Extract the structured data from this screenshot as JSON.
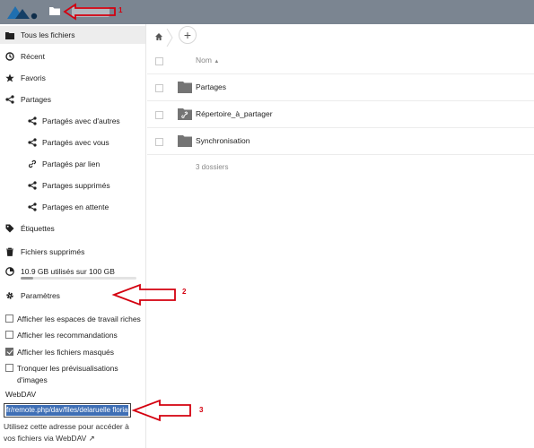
{
  "topbar": {
    "logo_icon": "nextcloud-logo-icon",
    "files_icon": "folder-icon"
  },
  "sidebar": {
    "items": [
      {
        "label": "Tous les fichiers",
        "icon": "folder-icon"
      },
      {
        "label": "Récent",
        "icon": "clock-icon"
      },
      {
        "label": "Favoris",
        "icon": "star-icon"
      },
      {
        "label": "Partages",
        "icon": "share-icon"
      },
      {
        "label": "Partagés avec d'autres",
        "icon": "share-icon"
      },
      {
        "label": "Partagés avec vous",
        "icon": "share-icon"
      },
      {
        "label": "Partagés par lien",
        "icon": "link-icon"
      },
      {
        "label": "Partages supprimés",
        "icon": "share-icon"
      },
      {
        "label": "Partages en attente",
        "icon": "share-icon"
      },
      {
        "label": "Étiquettes",
        "icon": "tag-icon"
      },
      {
        "label": "Fichiers supprimés",
        "icon": "trash-icon"
      }
    ],
    "quota": {
      "label": "10.9 GB utilisés sur 100 GB",
      "used_fraction": 0.11
    },
    "settings_label": "Paramètres"
  },
  "settings": {
    "options": [
      {
        "label": "Afficher les espaces de travail riches",
        "checked": false
      },
      {
        "label": "Afficher les recommandations",
        "checked": false
      },
      {
        "label": "Afficher les fichiers masqués",
        "checked": true
      },
      {
        "label": "Tronquer les prévisualisations d'images",
        "checked": false
      }
    ],
    "webdav_title": "WebDAV",
    "webdav_value": "fr/remote.php/dav/files/delaruelle florian/",
    "webdav_hint": "Utilisez cette adresse pour accéder à vos fichiers via WebDAV ↗"
  },
  "main": {
    "column_name": "Nom",
    "files": [
      {
        "name": "Partages",
        "icon": "folder-icon"
      },
      {
        "name": "Répertoire_à_partager",
        "icon": "shared-folder-icon"
      },
      {
        "name": "Synchronisation",
        "icon": "folder-icon"
      }
    ],
    "summary": "3 dossiers"
  },
  "annotations": {
    "a1": "1",
    "a2": "2",
    "a3": "3",
    "color": "#d4000f"
  }
}
